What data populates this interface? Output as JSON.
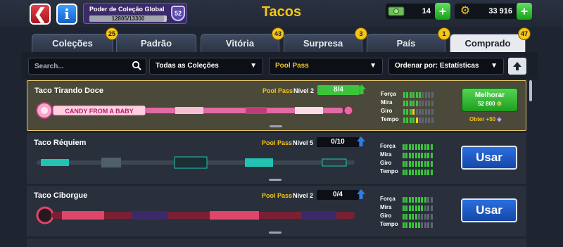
{
  "header": {
    "title": "Tacos",
    "back_icon": "back-arrow-icon",
    "info_icon": "info-icon",
    "collection": {
      "label": "Poder de Coleção Global",
      "progress_text": "12805/13300",
      "progress_fraction": 0.963,
      "level": "52"
    },
    "cash": {
      "icon": "cash-icon",
      "amount": "14"
    },
    "coins": {
      "icon": "coin-icon",
      "amount": "33 916"
    }
  },
  "tabs": [
    {
      "label": "Coleções",
      "badge": "25",
      "active": false
    },
    {
      "label": "Padrão",
      "badge": "",
      "active": false
    },
    {
      "label": "Vitória",
      "badge": "43",
      "active": false
    },
    {
      "label": "Surpresa",
      "badge": "3",
      "active": false
    },
    {
      "label": "País",
      "badge": "1",
      "active": false
    },
    {
      "label": "Comprado",
      "badge": "47",
      "active": true
    }
  ],
  "filters": {
    "search_placeholder": "Search...",
    "collections": "Todas as Coleções",
    "category": "Pool Pass",
    "sort": "Ordenar por: Estatísticas"
  },
  "colors": {
    "accent_yellow": "#f5c518",
    "green": "#3dc43d",
    "blue": "#1f5cc8",
    "card": "#2a303b",
    "card_selected": "#4b4a3a"
  },
  "stat_labels": [
    "Força",
    "Mira",
    "Giro",
    "Tempo"
  ],
  "cues": [
    {
      "name": "Taco Tirando Doce",
      "tag": "Pool Pass",
      "level": "Nível 2",
      "progress": "8/4",
      "progress_fraction": 1.0,
      "cue_text": "CANDY FROM A BABY",
      "stats": [
        6,
        5,
        4,
        5
      ],
      "stat_highlight": [
        0,
        0,
        1,
        1
      ],
      "selected": true,
      "action": "Melhorar",
      "cost": "52 800",
      "obtain": "Obter +50"
    },
    {
      "name": "Taco Réquiem",
      "tag": "Pool Pass",
      "level": "Nível 5",
      "progress": "0/10",
      "progress_fraction": 0,
      "cue_text": "",
      "stats": [
        10,
        10,
        10,
        10
      ],
      "stat_highlight": [
        0,
        0,
        0,
        0
      ],
      "selected": false,
      "action": "Usar"
    },
    {
      "name": "Taco Ciborgue",
      "tag": "Pool Pass",
      "level": "Nível 2",
      "progress": "0/4",
      "progress_fraction": 0,
      "cue_text": "",
      "stats": [
        8,
        7,
        5,
        6
      ],
      "stat_highlight": [
        0,
        0,
        0,
        0
      ],
      "selected": false,
      "action": "Usar"
    }
  ]
}
